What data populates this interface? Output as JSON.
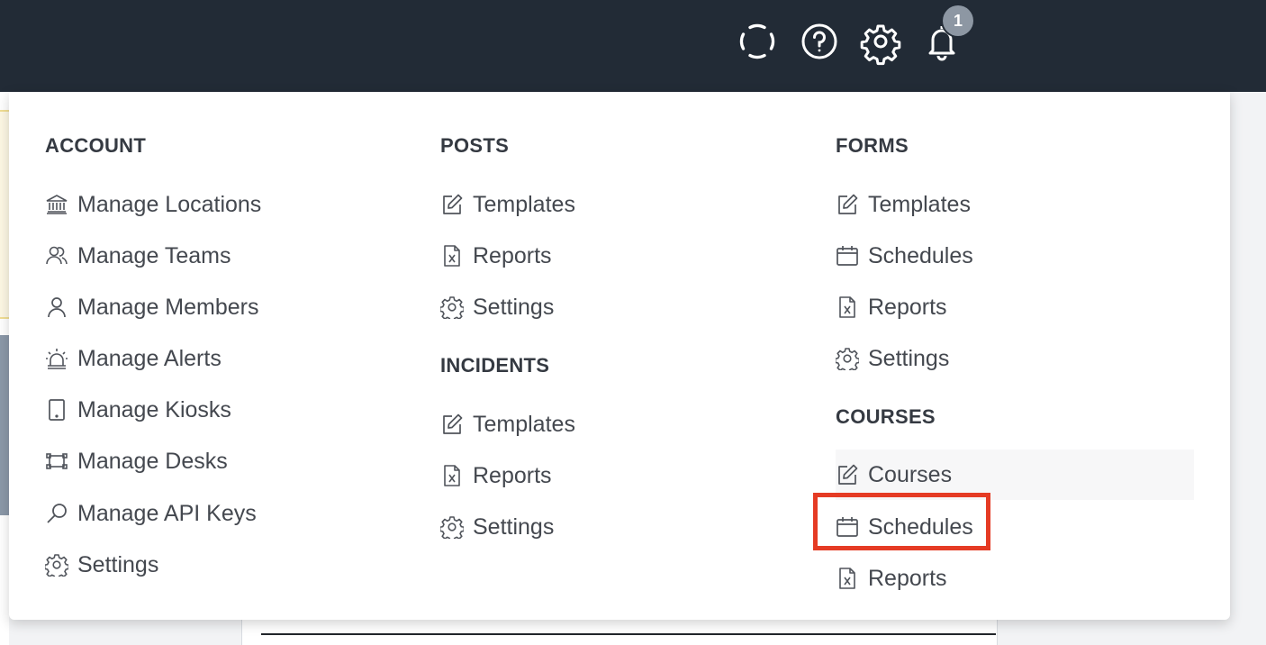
{
  "topbar": {
    "icons": [
      "loading-ring-icon",
      "help-icon",
      "gear-icon",
      "bell-icon"
    ],
    "notification_count": "1"
  },
  "menu": {
    "account": {
      "heading": "ACCOUNT",
      "items": [
        {
          "label": "Manage Locations",
          "icon": "building-icon"
        },
        {
          "label": "Manage Teams",
          "icon": "team-icon"
        },
        {
          "label": "Manage Members",
          "icon": "user-icon"
        },
        {
          "label": "Manage Alerts",
          "icon": "alarm-icon"
        },
        {
          "label": "Manage Kiosks",
          "icon": "tablet-icon"
        },
        {
          "label": "Manage Desks",
          "icon": "desk-icon"
        },
        {
          "label": "Manage API Keys",
          "icon": "key-search-icon"
        },
        {
          "label": "Settings",
          "icon": "gear-icon"
        }
      ]
    },
    "posts": {
      "heading": "POSTS",
      "items": [
        {
          "label": "Templates",
          "icon": "edit-icon"
        },
        {
          "label": "Reports",
          "icon": "excel-file-icon"
        },
        {
          "label": "Settings",
          "icon": "gear-icon"
        }
      ]
    },
    "incidents": {
      "heading": "INCIDENTS",
      "items": [
        {
          "label": "Templates",
          "icon": "edit-icon"
        },
        {
          "label": "Reports",
          "icon": "excel-file-icon"
        },
        {
          "label": "Settings",
          "icon": "gear-icon"
        }
      ]
    },
    "forms": {
      "heading": "FORMS",
      "items": [
        {
          "label": "Templates",
          "icon": "edit-icon"
        },
        {
          "label": "Schedules",
          "icon": "calendar-icon"
        },
        {
          "label": "Reports",
          "icon": "excel-file-icon"
        },
        {
          "label": "Settings",
          "icon": "gear-icon"
        }
      ]
    },
    "courses": {
      "heading": "COURSES",
      "items": [
        {
          "label": "Courses",
          "icon": "edit-icon"
        },
        {
          "label": "Schedules",
          "icon": "calendar-icon"
        },
        {
          "label": "Reports",
          "icon": "excel-file-icon"
        }
      ]
    }
  },
  "colors": {
    "topbar_bg": "#222b36",
    "highlight_border": "#e53b24",
    "badge_bg": "#8d97a3"
  }
}
